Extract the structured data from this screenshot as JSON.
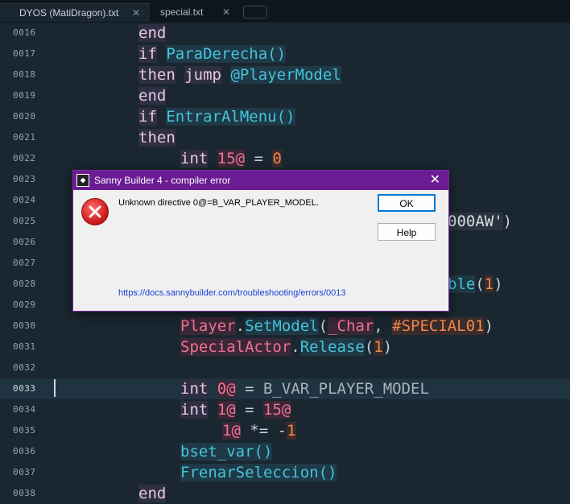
{
  "tabs": [
    {
      "label": "DYOS (MatiDragon).txt",
      "close": "✕"
    },
    {
      "label": "special.txt",
      "close": "✕"
    }
  ],
  "lines": [
    {
      "n": "0016",
      "tokens": [
        {
          "t": "end",
          "c": "kw"
        }
      ],
      "indent": 172
    },
    {
      "n": "0017",
      "tokens": [
        {
          "t": "if",
          "c": "kw"
        },
        {
          "t": " ",
          "c": "op"
        },
        {
          "t": "ParaDerecha()",
          "c": "fn"
        }
      ],
      "indent": 172
    },
    {
      "n": "0018",
      "tokens": [
        {
          "t": "then",
          "c": "kw"
        },
        {
          "t": " ",
          "c": "op"
        },
        {
          "t": "jump",
          "c": "kw"
        },
        {
          "t": " ",
          "c": "op"
        },
        {
          "t": "@PlayerModel",
          "c": "fn"
        }
      ],
      "indent": 172
    },
    {
      "n": "0019",
      "tokens": [
        {
          "t": "end",
          "c": "kw"
        }
      ],
      "indent": 172
    },
    {
      "n": "0020",
      "tokens": [
        {
          "t": "if",
          "c": "kw"
        },
        {
          "t": " ",
          "c": "op"
        },
        {
          "t": "EntrarAlMenu()",
          "c": "fn"
        }
      ],
      "indent": 172
    },
    {
      "n": "0021",
      "tokens": [
        {
          "t": "then",
          "c": "kw"
        }
      ],
      "indent": 172
    },
    {
      "n": "0022",
      "tokens": [
        {
          "t": "int",
          "c": "kw"
        },
        {
          "t": " ",
          "c": "op"
        },
        {
          "t": "15@",
          "c": "var"
        },
        {
          "t": " = ",
          "c": "op"
        },
        {
          "t": "0",
          "c": "num"
        }
      ],
      "indent": 224
    },
    {
      "n": "0023",
      "tokens": [],
      "indent": 224
    },
    {
      "n": "0024",
      "tokens": [],
      "indent": 224
    },
    {
      "n": "0025",
      "tokens": [
        {
          "t": "000AW'",
          "c": "str"
        },
        {
          "t": ")",
          "c": "op"
        }
      ],
      "indent": 556
    },
    {
      "n": "0026",
      "tokens": [],
      "indent": 224
    },
    {
      "n": "0027",
      "tokens": [],
      "indent": 224
    },
    {
      "n": "0028",
      "tokens": [
        {
          "t": "ble",
          "c": "fn"
        },
        {
          "t": "(",
          "c": "op"
        },
        {
          "t": "1",
          "c": "num"
        },
        {
          "t": ")",
          "c": "op"
        }
      ],
      "indent": 556
    },
    {
      "n": "0029",
      "tokens": [],
      "indent": 224
    },
    {
      "n": "0030",
      "tokens": [
        {
          "t": "Player",
          "c": "var"
        },
        {
          "t": ".",
          "c": "op"
        },
        {
          "t": "SetModel",
          "c": "fn"
        },
        {
          "t": "(",
          "c": "op"
        },
        {
          "t": "_Char",
          "c": "var"
        },
        {
          "t": ", ",
          "c": "op"
        },
        {
          "t": "#SPECIAL01",
          "c": "num"
        },
        {
          "t": ")",
          "c": "op"
        }
      ],
      "indent": 224
    },
    {
      "n": "0031",
      "tokens": [
        {
          "t": "SpecialActor",
          "c": "var"
        },
        {
          "t": ".",
          "c": "op"
        },
        {
          "t": "Release",
          "c": "fn"
        },
        {
          "t": "(",
          "c": "op"
        },
        {
          "t": "1",
          "c": "num"
        },
        {
          "t": ")",
          "c": "op"
        }
      ],
      "indent": 224
    },
    {
      "n": "0032",
      "tokens": [],
      "indent": 224
    },
    {
      "n": "0033",
      "tokens": [
        {
          "t": "int",
          "c": "kw"
        },
        {
          "t": " ",
          "c": "op"
        },
        {
          "t": "0@",
          "c": "var"
        },
        {
          "t": " = ",
          "c": "op"
        },
        {
          "t": "B_VAR_PLAYER_MODEL",
          "c": "const"
        }
      ],
      "indent": 224,
      "current": true
    },
    {
      "n": "0034",
      "tokens": [
        {
          "t": "int",
          "c": "kw"
        },
        {
          "t": " ",
          "c": "op"
        },
        {
          "t": "1@",
          "c": "var"
        },
        {
          "t": " = ",
          "c": "op"
        },
        {
          "t": "15@",
          "c": "var"
        }
      ],
      "indent": 224
    },
    {
      "n": "0035",
      "tokens": [
        {
          "t": "1@",
          "c": "var"
        },
        {
          "t": " *= -",
          "c": "op"
        },
        {
          "t": "1",
          "c": "num"
        }
      ],
      "indent": 276
    },
    {
      "n": "0036",
      "tokens": [
        {
          "t": "bset_var()",
          "c": "fn"
        }
      ],
      "indent": 224
    },
    {
      "n": "0037",
      "tokens": [
        {
          "t": "FrenarSeleccion()",
          "c": "fn"
        }
      ],
      "indent": 224
    },
    {
      "n": "0038",
      "tokens": [
        {
          "t": "end",
          "c": "kw"
        }
      ],
      "indent": 172
    }
  ],
  "dialog": {
    "title": "Sanny Builder 4 - compiler error",
    "close": "✕",
    "message": "Unknown directive 0@=B_VAR_PLAYER_MODEL.",
    "ok_label": "OK",
    "help_label": "Help",
    "link": "https://docs.sannybuilder.com/troubleshooting/errors/0013"
  }
}
